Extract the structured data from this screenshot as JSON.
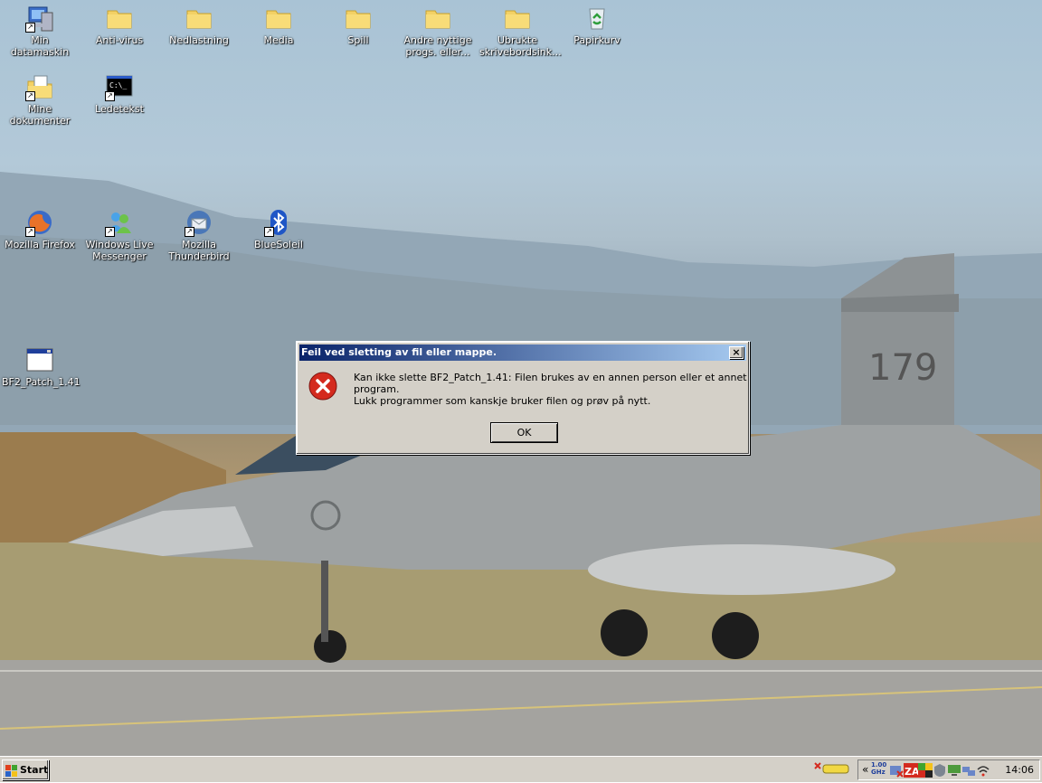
{
  "desktop": {
    "icons": [
      {
        "label": "Min datamaskin"
      },
      {
        "label": "Anti-virus"
      },
      {
        "label": "Nedlastning"
      },
      {
        "label": "Media"
      },
      {
        "label": "Spill"
      },
      {
        "label": "Andre nyttige progs. eller..."
      },
      {
        "label": "Ubrukte skrivebordsink..."
      },
      {
        "label": "Papirkurv"
      },
      {
        "label": "Mine dokumenter"
      },
      {
        "label": "Ledetekst"
      },
      {
        "label": "Mozilla Firefox"
      },
      {
        "label": "Windows Live Messenger"
      },
      {
        "label": "Mozilla Thunderbird"
      },
      {
        "label": "BlueSoleil"
      },
      {
        "label": "BF2_Patch_1.41"
      }
    ],
    "wallpaper_marking": "179"
  },
  "dialog": {
    "title": "Feil ved sletting av fil eller mappe.",
    "close_label": "×",
    "message_line1": "Kan ikke slette BF2_Patch_1.41: Filen brukes av en annen person eller et annet program.",
    "message_line2": "Lukk programmer som kanskje bruker filen og prøv på nytt.",
    "ok_label": "OK",
    "icon": "error-icon"
  },
  "taskbar": {
    "start_label": "Start",
    "tray_expand": "«",
    "cpu_label": "1.00 GHz",
    "clock": "14:06"
  },
  "colors": {
    "titlebar_start": "#0a246a",
    "titlebar_end": "#a6caf0",
    "dialog_face": "#d4d0c8",
    "error_red": "#d42a1e"
  }
}
